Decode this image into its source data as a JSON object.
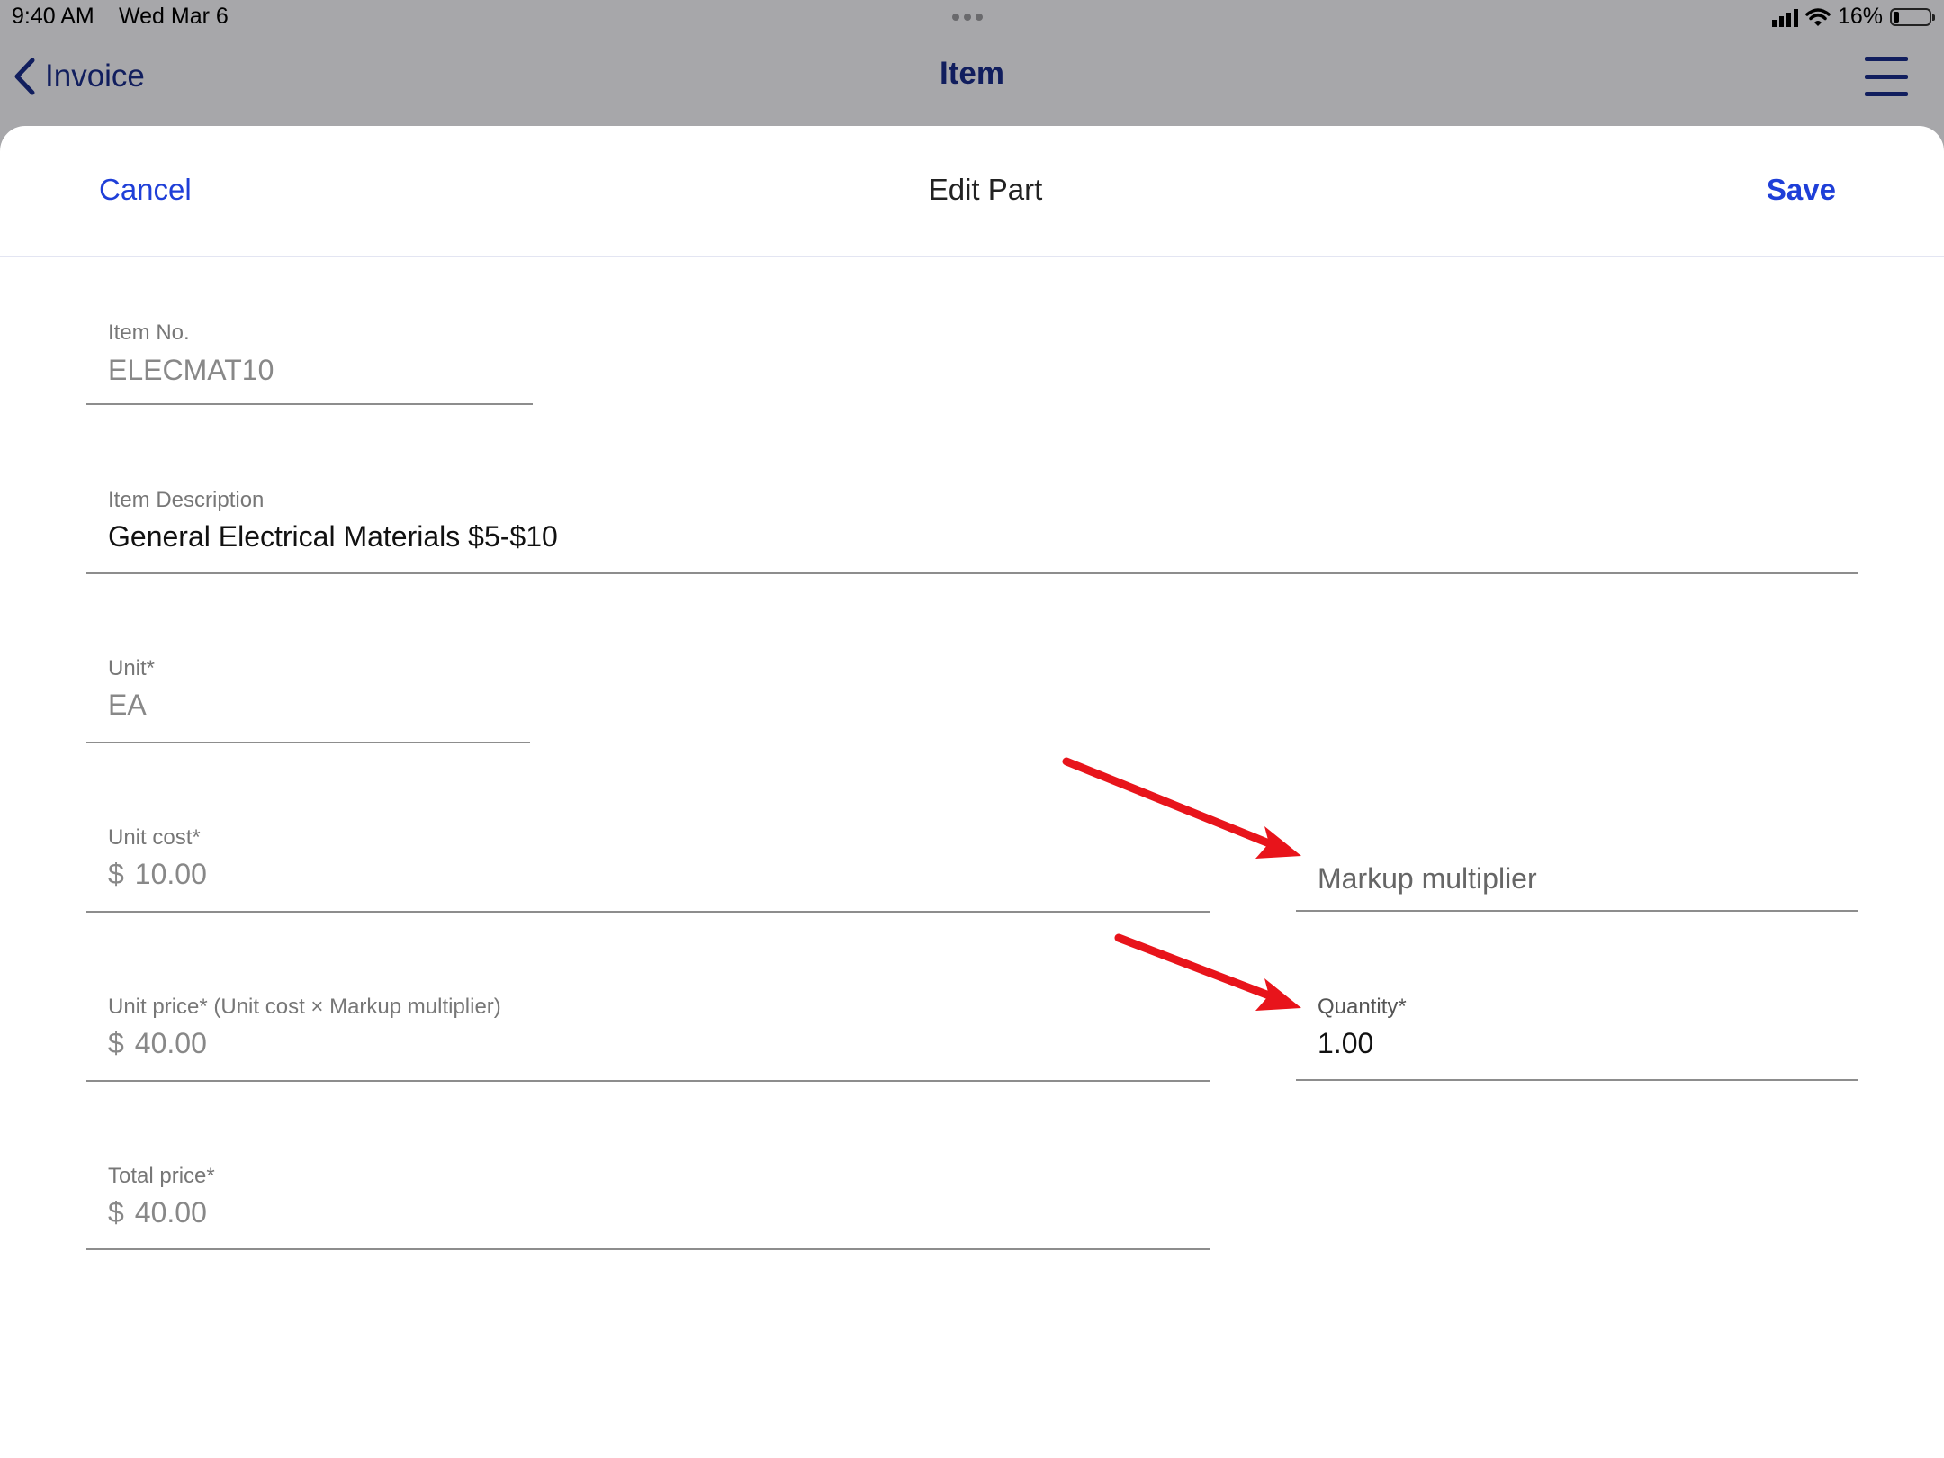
{
  "status_bar": {
    "time": "9:40 AM",
    "date": "Wed Mar 6",
    "battery": "16%",
    "battery_level": 0.16,
    "icons": [
      "signal-icon",
      "wifi-icon",
      "battery-icon"
    ]
  },
  "nav": {
    "back_label": "Invoice",
    "title": "Item",
    "icons": [
      "chevron-left-icon",
      "hamburger-menu-icon"
    ]
  },
  "sheet": {
    "cancel_label": "Cancel",
    "title": "Edit Part",
    "save_label": "Save"
  },
  "form": {
    "item_no": {
      "label": "Item No.",
      "value": "ELECMAT10"
    },
    "item_description": {
      "label": "Item Description",
      "value": "General Electrical Materials $5-$10"
    },
    "unit": {
      "label": "Unit*",
      "value": "EA"
    },
    "unit_cost": {
      "label": "Unit cost*",
      "currency": "$",
      "value": "10.00"
    },
    "markup_multiplier": {
      "placeholder": "Markup multiplier"
    },
    "unit_price": {
      "label": "Unit price* (Unit cost × Markup multiplier)",
      "currency": "$",
      "value": "40.00"
    },
    "quantity": {
      "label": "Quantity*",
      "value": "1.00"
    },
    "total_price": {
      "label": "Total price*",
      "currency": "$",
      "value": "40.00"
    }
  },
  "colors": {
    "accent": "#1f3fd8",
    "nav_text": "#111e5e",
    "annotation_arrow": "#e8141b",
    "dimmed_background": "#a7a7aa"
  }
}
